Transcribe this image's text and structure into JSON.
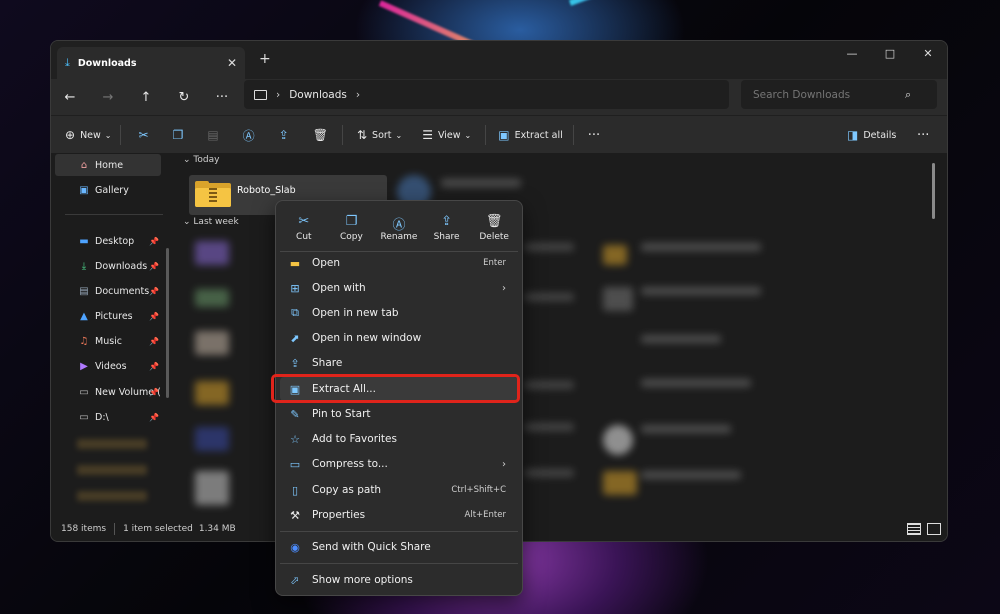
{
  "window": {
    "tab_label": "Downloads",
    "new_tab": "+",
    "controls": [
      "—",
      "□",
      "✕"
    ]
  },
  "addressbar": {
    "crumbs": [
      "Downloads"
    ],
    "search_placeholder": "Search Downloads"
  },
  "commandbar": {
    "new_label": "New",
    "sort_label": "Sort",
    "view_label": "View",
    "extract_all_label": "Extract all",
    "more": "···",
    "details_label": "Details",
    "more2": "···"
  },
  "sidebar": {
    "items": [
      {
        "label": "Home",
        "icon": "home-icon"
      },
      {
        "label": "Gallery",
        "icon": "gallery-icon"
      },
      {
        "label": "Desktop",
        "icon": "desktop-icon"
      },
      {
        "label": "Downloads",
        "icon": "download-icon"
      },
      {
        "label": "Documents",
        "icon": "documents-icon"
      },
      {
        "label": "Pictures",
        "icon": "pictures-icon"
      },
      {
        "label": "Music",
        "icon": "music-icon"
      },
      {
        "label": "Videos",
        "icon": "videos-icon"
      },
      {
        "label": "New Volume (",
        "icon": "drive-icon"
      },
      {
        "label": "D:\\",
        "icon": "drive-icon"
      }
    ]
  },
  "files": {
    "group_today": "Today",
    "group_last_week": "Last week",
    "selected_file": "Roboto_Slab"
  },
  "statusbar": {
    "count": "158 items",
    "selection": "1 item selected",
    "size": "1.34 MB"
  },
  "context_menu": {
    "quick_actions": [
      {
        "label": "Cut",
        "icon": "scissors-icon"
      },
      {
        "label": "Copy",
        "icon": "copy-icon"
      },
      {
        "label": "Rename",
        "icon": "rename-icon"
      },
      {
        "label": "Share",
        "icon": "share-icon"
      },
      {
        "label": "Delete",
        "icon": "trash-icon"
      }
    ],
    "items": [
      {
        "label": "Open",
        "shortcut": "Enter"
      },
      {
        "label": "Open with",
        "submenu": "›"
      },
      {
        "label": "Open in new tab"
      },
      {
        "label": "Open in new window"
      },
      {
        "label": "Share"
      },
      {
        "label": "Extract All..."
      },
      {
        "label": "Pin to Start"
      },
      {
        "label": "Add to Favorites"
      },
      {
        "label": "Compress to...",
        "submenu": "›"
      },
      {
        "label": "Copy as path",
        "shortcut": "Ctrl+Shift+C"
      },
      {
        "label": "Properties",
        "shortcut": "Alt+Enter"
      },
      {
        "label": "Send with Quick Share"
      },
      {
        "label": "Show more options"
      }
    ],
    "highlighted": "Extract All..."
  }
}
